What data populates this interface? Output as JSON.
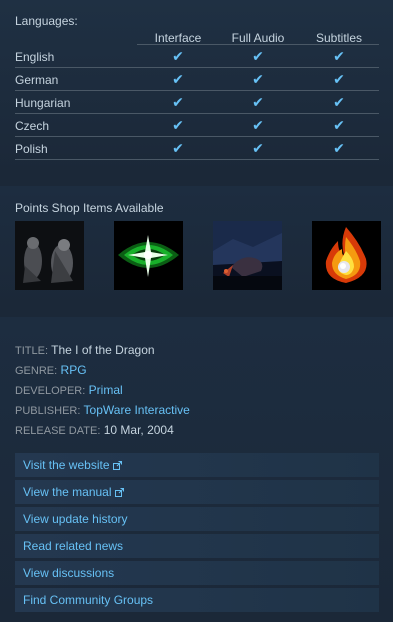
{
  "languages": {
    "heading": "Languages:",
    "columns": [
      "Interface",
      "Full Audio",
      "Subtitles"
    ],
    "rows": [
      {
        "name": "English",
        "interface": "✔",
        "audio": "✔",
        "subtitles": "✔"
      },
      {
        "name": "German",
        "interface": "✔",
        "audio": "✔",
        "subtitles": "✔"
      },
      {
        "name": "Hungarian",
        "interface": "✔",
        "audio": "✔",
        "subtitles": "✔"
      },
      {
        "name": "Czech",
        "interface": "✔",
        "audio": "✔",
        "subtitles": "✔"
      },
      {
        "name": "Polish",
        "interface": "✔",
        "audio": "✔",
        "subtitles": "✔"
      }
    ]
  },
  "points_shop": {
    "heading": "Points Shop Items Available",
    "items": [
      {
        "icon": "characters-artwork-icon"
      },
      {
        "icon": "green-eye-icon"
      },
      {
        "icon": "dragon-scene-icon"
      },
      {
        "icon": "fire-emblem-icon"
      }
    ]
  },
  "details": {
    "title_label": "TITLE:",
    "title_value": "The I of the Dragon",
    "genre_label": "GENRE:",
    "genre_value": "RPG",
    "developer_label": "DEVELOPER:",
    "developer_value": "Primal",
    "publisher_label": "PUBLISHER:",
    "publisher_value": "TopWare Interactive",
    "release_label": "RELEASE DATE:",
    "release_value": "10 Mar, 2004"
  },
  "links": {
    "website": "Visit the website",
    "manual": "View the manual",
    "history": "View update history",
    "news": "Read related news",
    "discussions": "View discussions",
    "groups": "Find Community Groups"
  },
  "colors": {
    "background": "#1b2838",
    "accent": "#67c1f5",
    "text": "#c6d4df",
    "muted": "#8f98a0"
  }
}
